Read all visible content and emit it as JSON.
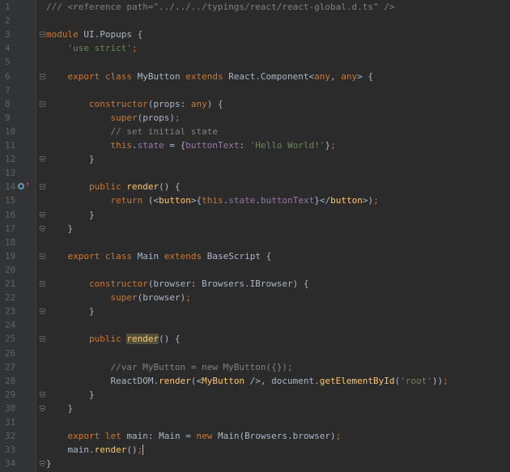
{
  "editor": {
    "language": "TypeScript",
    "colors": {
      "background": "#2b2b2b",
      "keyword": "#cc7832",
      "string": "#6a8759",
      "comment": "#808080",
      "function": "#ffc66d",
      "field": "#9876aa",
      "text": "#a9b7c6",
      "line_number": "#606366"
    },
    "gutter_icons": [
      "override-method-icon",
      "fold-marker-icon"
    ],
    "lines": [
      {
        "n": "1",
        "segments": [
          {
            "t": "/// <reference path=\"../../../typings/react/react-global.d.ts\" />",
            "c": "cm"
          }
        ]
      },
      {
        "n": "2",
        "segments": []
      },
      {
        "n": "3",
        "segments": [
          {
            "t": "module",
            "c": "kw"
          },
          {
            "t": " UI.Popups {",
            "c": ""
          }
        ]
      },
      {
        "n": "4",
        "segments": [
          {
            "t": "    ",
            "c": ""
          },
          {
            "t": "'use strict'",
            "c": "str"
          },
          {
            "t": ";",
            "c": "kw"
          }
        ]
      },
      {
        "n": "5",
        "segments": []
      },
      {
        "n": "6",
        "segments": [
          {
            "t": "    ",
            "c": ""
          },
          {
            "t": "export class",
            "c": "kw"
          },
          {
            "t": " MyButton ",
            "c": ""
          },
          {
            "t": "extends",
            "c": "kw"
          },
          {
            "t": " React.Component<",
            "c": ""
          },
          {
            "t": "any",
            "c": "kw"
          },
          {
            "t": ", ",
            "c": ""
          },
          {
            "t": "any",
            "c": "kw"
          },
          {
            "t": "> {",
            "c": ""
          }
        ]
      },
      {
        "n": "7",
        "segments": []
      },
      {
        "n": "8",
        "segments": [
          {
            "t": "        ",
            "c": ""
          },
          {
            "t": "constructor",
            "c": "kw"
          },
          {
            "t": "(props: ",
            "c": ""
          },
          {
            "t": "any",
            "c": "kw"
          },
          {
            "t": ") {",
            "c": ""
          }
        ]
      },
      {
        "n": "9",
        "segments": [
          {
            "t": "            ",
            "c": ""
          },
          {
            "t": "super",
            "c": "kw"
          },
          {
            "t": "(props)",
            "c": ""
          },
          {
            "t": ";",
            "c": "kw"
          }
        ]
      },
      {
        "n": "10",
        "segments": [
          {
            "t": "            ",
            "c": ""
          },
          {
            "t": "// set initial state",
            "c": "cm"
          }
        ]
      },
      {
        "n": "11",
        "segments": [
          {
            "t": "            ",
            "c": ""
          },
          {
            "t": "this",
            "c": "kw"
          },
          {
            "t": ".",
            "c": ""
          },
          {
            "t": "state",
            "c": "fld"
          },
          {
            "t": " = {",
            "c": ""
          },
          {
            "t": "buttonText",
            "c": "fld"
          },
          {
            "t": ": ",
            "c": ""
          },
          {
            "t": "'Hello World!'",
            "c": "str"
          },
          {
            "t": "}",
            "c": ""
          },
          {
            "t": ";",
            "c": "kw"
          }
        ]
      },
      {
        "n": "12",
        "segments": [
          {
            "t": "        }",
            "c": ""
          }
        ]
      },
      {
        "n": "13",
        "segments": []
      },
      {
        "n": "14",
        "segments": [
          {
            "t": "        ",
            "c": ""
          },
          {
            "t": "public",
            "c": "kw"
          },
          {
            "t": " ",
            "c": ""
          },
          {
            "t": "render",
            "c": "fn"
          },
          {
            "t": "() {",
            "c": ""
          }
        ]
      },
      {
        "n": "15",
        "segments": [
          {
            "t": "            ",
            "c": ""
          },
          {
            "t": "return",
            "c": "kw"
          },
          {
            "t": " (<",
            "c": ""
          },
          {
            "t": "button",
            "c": "fn"
          },
          {
            "t": ">{",
            "c": ""
          },
          {
            "t": "this",
            "c": "kw"
          },
          {
            "t": ".",
            "c": ""
          },
          {
            "t": "state",
            "c": "fld"
          },
          {
            "t": ".",
            "c": ""
          },
          {
            "t": "buttonText",
            "c": "fld"
          },
          {
            "t": "}</",
            "c": ""
          },
          {
            "t": "button",
            "c": "fn"
          },
          {
            "t": ">)",
            "c": ""
          },
          {
            "t": ";",
            "c": "kw"
          }
        ]
      },
      {
        "n": "16",
        "segments": [
          {
            "t": "        }",
            "c": ""
          }
        ]
      },
      {
        "n": "17",
        "segments": [
          {
            "t": "    }",
            "c": ""
          }
        ]
      },
      {
        "n": "18",
        "segments": []
      },
      {
        "n": "19",
        "segments": [
          {
            "t": "    ",
            "c": ""
          },
          {
            "t": "export class",
            "c": "kw"
          },
          {
            "t": " Main ",
            "c": ""
          },
          {
            "t": "extends",
            "c": "kw"
          },
          {
            "t": " BaseScript {",
            "c": ""
          }
        ]
      },
      {
        "n": "20",
        "segments": []
      },
      {
        "n": "21",
        "segments": [
          {
            "t": "        ",
            "c": ""
          },
          {
            "t": "constructor",
            "c": "kw"
          },
          {
            "t": "(browser: Browsers.IBrowser) {",
            "c": ""
          }
        ]
      },
      {
        "n": "22",
        "segments": [
          {
            "t": "            ",
            "c": ""
          },
          {
            "t": "super",
            "c": "kw"
          },
          {
            "t": "(browser)",
            "c": ""
          },
          {
            "t": ";",
            "c": "kw"
          }
        ]
      },
      {
        "n": "23",
        "segments": [
          {
            "t": "        }",
            "c": ""
          }
        ]
      },
      {
        "n": "24",
        "segments": []
      },
      {
        "n": "25",
        "segments": [
          {
            "t": "        ",
            "c": ""
          },
          {
            "t": "public",
            "c": "kw"
          },
          {
            "t": " ",
            "c": ""
          },
          {
            "t": "render",
            "c": "fn hl"
          },
          {
            "t": "() {",
            "c": ""
          }
        ]
      },
      {
        "n": "26",
        "segments": []
      },
      {
        "n": "27",
        "segments": [
          {
            "t": "            ",
            "c": ""
          },
          {
            "t": "//var MyButton = new MyButton({});",
            "c": "cm"
          }
        ]
      },
      {
        "n": "28",
        "segments": [
          {
            "t": "            ReactDOM.",
            "c": ""
          },
          {
            "t": "render",
            "c": "fn"
          },
          {
            "t": "(<",
            "c": ""
          },
          {
            "t": "MyButton",
            "c": "fn"
          },
          {
            "t": " />, document.",
            "c": ""
          },
          {
            "t": "getElementById",
            "c": "fn"
          },
          {
            "t": "(",
            "c": ""
          },
          {
            "t": "'root'",
            "c": "str"
          },
          {
            "t": "))",
            "c": ""
          },
          {
            "t": ";",
            "c": "kw"
          }
        ]
      },
      {
        "n": "29",
        "segments": [
          {
            "t": "        }",
            "c": ""
          }
        ]
      },
      {
        "n": "30",
        "segments": [
          {
            "t": "    }",
            "c": ""
          }
        ]
      },
      {
        "n": "31",
        "segments": []
      },
      {
        "n": "32",
        "segments": [
          {
            "t": "    ",
            "c": ""
          },
          {
            "t": "export let",
            "c": "kw"
          },
          {
            "t": " main: Main = ",
            "c": ""
          },
          {
            "t": "new",
            "c": "kw"
          },
          {
            "t": " Main(Browsers.browser)",
            "c": ""
          },
          {
            "t": ";",
            "c": "kw"
          }
        ]
      },
      {
        "n": "33",
        "segments": [
          {
            "t": "    main.",
            "c": ""
          },
          {
            "t": "render",
            "c": "fn"
          },
          {
            "t": "()",
            "c": ""
          },
          {
            "t": ";",
            "c": "kw caret"
          }
        ]
      },
      {
        "n": "34",
        "segments": [
          {
            "t": "}",
            "c": ""
          }
        ]
      }
    ]
  }
}
